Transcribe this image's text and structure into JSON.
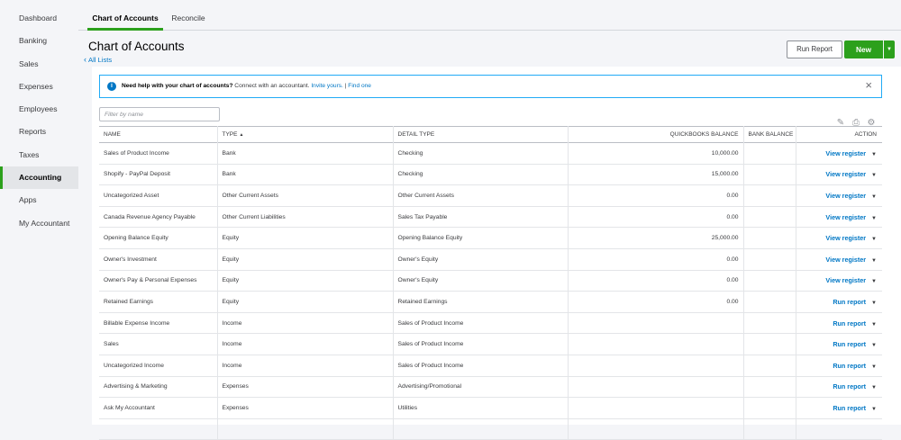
{
  "sidebar": {
    "items": [
      {
        "label": "Dashboard"
      },
      {
        "label": "Banking"
      },
      {
        "label": "Sales"
      },
      {
        "label": "Expenses"
      },
      {
        "label": "Employees"
      },
      {
        "label": "Reports"
      },
      {
        "label": "Taxes"
      },
      {
        "label": "Accounting"
      },
      {
        "label": "Apps"
      },
      {
        "label": "My Accountant"
      }
    ],
    "active": "Accounting"
  },
  "tabs": [
    {
      "label": "Chart of Accounts"
    },
    {
      "label": "Reconcile"
    }
  ],
  "header": {
    "title": "Chart of Accounts",
    "all_lists": "All Lists",
    "run_report": "Run Report",
    "new": "New"
  },
  "banner": {
    "bold": "Need help with your chart of accounts?",
    "text": " Connect with an accountant. ",
    "invite": "Invite yours.",
    "sep": " | ",
    "find": "Find one"
  },
  "filter": {
    "placeholder": "Filter by name"
  },
  "table": {
    "columns": {
      "name": "NAME",
      "type": "TYPE",
      "detail": "DETAIL TYPE",
      "qb": "QUICKBOOKS BALANCE",
      "bank": "BANK BALANCE",
      "action": "ACTION"
    },
    "sort_indicator": "▲",
    "rows": [
      {
        "name": "Sales of Product Income",
        "type": "Bank",
        "detail": "Checking",
        "qb": "10,000.00",
        "bank": "",
        "action": "View register"
      },
      {
        "name": "Shopify - PayPal Deposit",
        "type": "Bank",
        "detail": "Checking",
        "qb": "15,000.00",
        "bank": "",
        "action": "View register"
      },
      {
        "name": "Uncategorized Asset",
        "type": "Other Current Assets",
        "detail": "Other Current Assets",
        "qb": "0.00",
        "bank": "",
        "action": "View register"
      },
      {
        "name": "Canada Revenue Agency Payable",
        "type": "Other Current Liabilities",
        "detail": "Sales Tax Payable",
        "qb": "0.00",
        "bank": "",
        "action": "View register"
      },
      {
        "name": "Opening Balance Equity",
        "type": "Equity",
        "detail": "Opening Balance Equity",
        "qb": "25,000.00",
        "bank": "",
        "action": "View register"
      },
      {
        "name": "Owner's Investment",
        "type": "Equity",
        "detail": "Owner's Equity",
        "qb": "0.00",
        "bank": "",
        "action": "View register"
      },
      {
        "name": "Owner's Pay & Personal Expenses",
        "type": "Equity",
        "detail": "Owner's Equity",
        "qb": "0.00",
        "bank": "",
        "action": "View register"
      },
      {
        "name": "Retained Earnings",
        "type": "Equity",
        "detail": "Retained Earnings",
        "qb": "0.00",
        "bank": "",
        "action": "Run report"
      },
      {
        "name": "Billable Expense Income",
        "type": "Income",
        "detail": "Sales of Product Income",
        "qb": "",
        "bank": "",
        "action": "Run report"
      },
      {
        "name": "Sales",
        "type": "Income",
        "detail": "Sales of Product Income",
        "qb": "",
        "bank": "",
        "action": "Run report"
      },
      {
        "name": "Uncategorized Income",
        "type": "Income",
        "detail": "Sales of Product Income",
        "qb": "",
        "bank": "",
        "action": "Run report"
      },
      {
        "name": "Advertising & Marketing",
        "type": "Expenses",
        "detail": "Advertising/Promotional",
        "qb": "",
        "bank": "",
        "action": "Run report"
      },
      {
        "name": "Ask My Accountant",
        "type": "Expenses",
        "detail": "Utilities",
        "qb": "",
        "bank": "",
        "action": "Run report"
      },
      {
        "name": "",
        "type": "",
        "detail": "",
        "qb": "",
        "bank": "",
        "action": ""
      }
    ]
  },
  "icons": {
    "info": "info-icon",
    "close": "close-icon",
    "edit": "pencil-icon",
    "print": "printer-icon",
    "settings": "gear-icon"
  },
  "colors": {
    "accent_green": "#2ca01c",
    "link_blue": "#0077c5",
    "banner_border": "#21abf6"
  }
}
